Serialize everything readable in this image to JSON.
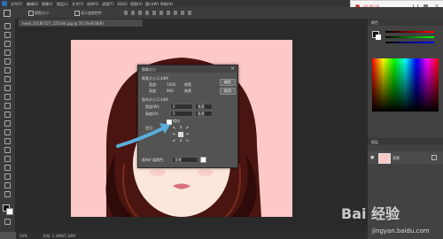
{
  "window": {
    "doc_tab_title": "head_20180727_225344.jpg @ 50.2%(RGB/8)",
    "zoom_status": "50%",
    "doc_status": "文档: 1.34M/1.34M"
  },
  "menubar": {
    "items": [
      "文件(F)",
      "编辑(E)",
      "图像(I)",
      "图层(L)",
      "文字(Y)",
      "选择(S)",
      "滤镜(T)",
      "3D(D)",
      "视图(V)",
      "窗口(W)",
      "帮助(H)"
    ]
  },
  "options_bar": {
    "label1": "视图大小",
    "label2": "显示变换控件"
  },
  "recorder": {
    "time": "00:00:18"
  },
  "dialog": {
    "title": "图像大小",
    "pixel_dims_label": "像素大小:2.44M",
    "width_label": "宽度:",
    "width_value": "1000",
    "width_unit": "像素",
    "height_label": "高度:",
    "height_value": "960",
    "height_unit": "像素",
    "doc_size_label": "画布大小:2.44M",
    "doc_width_label": "宽度(W):",
    "doc_width_value": "0",
    "doc_width_unit": "像素",
    "doc_height_label": "高度(H):",
    "doc_height_value": "0",
    "doc_height_unit": "像素",
    "relative_label": "相对",
    "anchor_label": "定位:",
    "canvas_ext_label": "画布扩展颜色:",
    "canvas_ext_value": "背景",
    "ok_label": "确定",
    "cancel_label": "取消"
  },
  "right_panel": {
    "color_tab": "颜色",
    "layers_tab": "图层",
    "layer_name": "背景"
  },
  "watermark": {
    "brand": "Bai  经验",
    "url": "jingyan.baidu.com"
  },
  "colors": {
    "photo_bg": "#fcc8c8",
    "highlight_arrow": "#5aaedc"
  }
}
